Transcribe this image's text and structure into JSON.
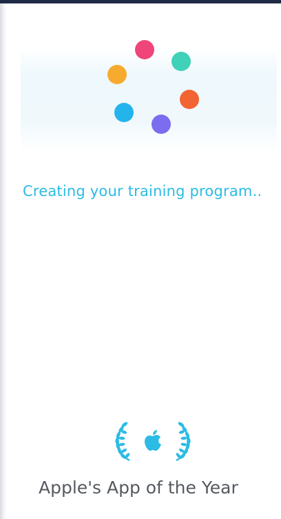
{
  "colors": {
    "status_bar": "#1e2a44",
    "loading_text": "#2bbbe4",
    "award_laurel": "#2bbbe4",
    "award_text": "#555a60"
  },
  "spinner": {
    "icon": "loading-dots",
    "dot_colors": [
      "#f0457a",
      "#3fd2b8",
      "#f26433",
      "#7b6cf0",
      "#23b4ec",
      "#f7ab2e"
    ]
  },
  "loading": {
    "message": "Creating your training program.."
  },
  "award": {
    "icon": "apple-logo-laurel",
    "label": "Apple's App of the Year"
  }
}
